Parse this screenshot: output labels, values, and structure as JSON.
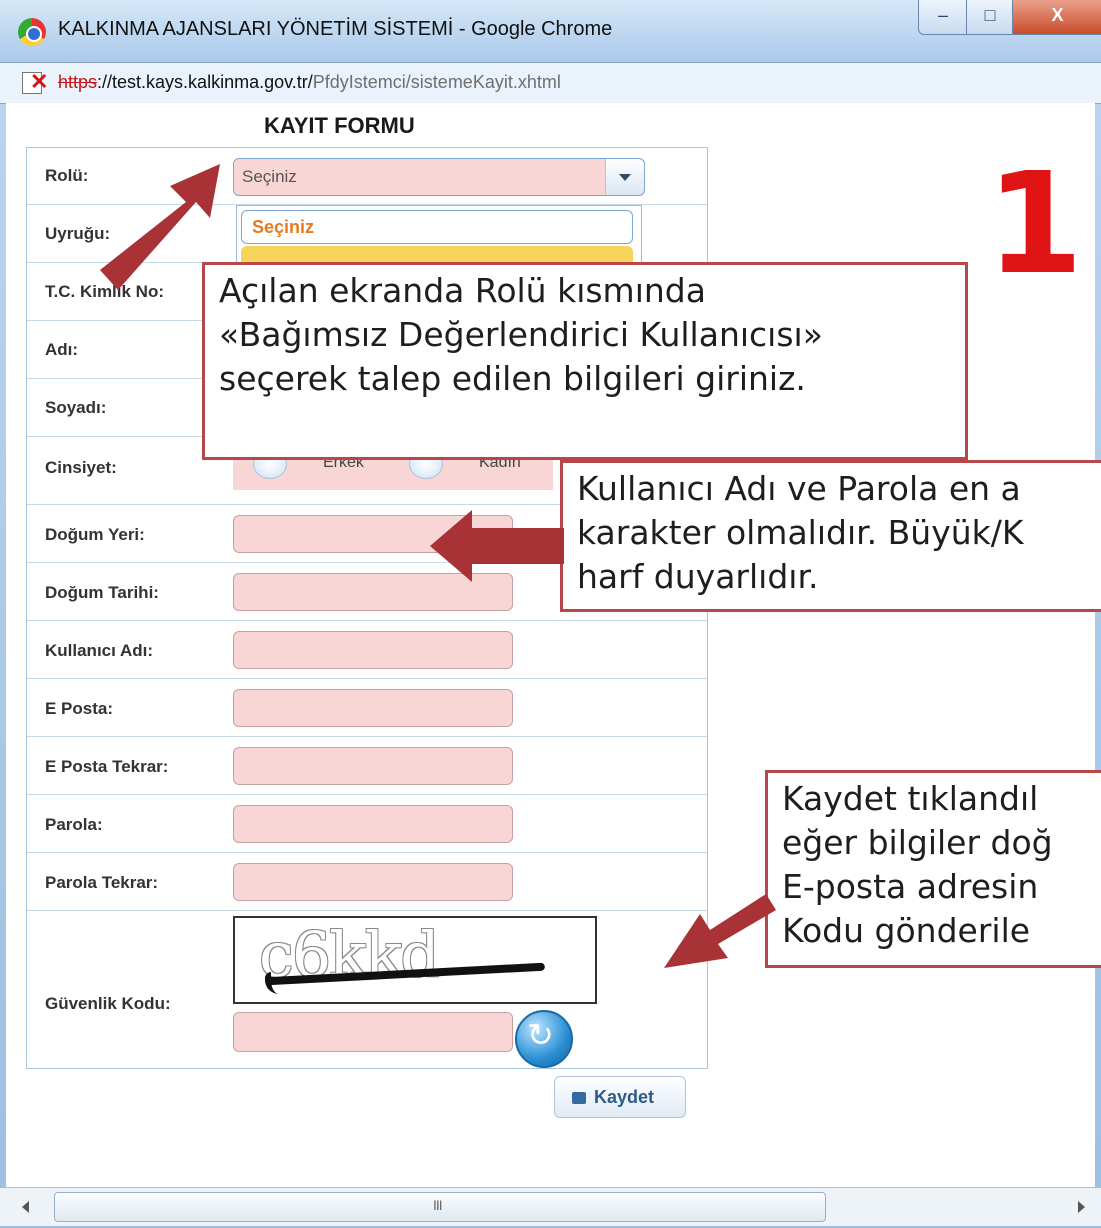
{
  "window": {
    "title": "KALKINMA AJANSLARI YÖNETİM SİSTEMİ - Google Chrome",
    "url_scheme": "https",
    "url_host": "://test.kays.kalkinma.gov.tr/",
    "url_path": "PfdyIstemci/sistemeKayit.xhtml",
    "minimize_glyph": "–",
    "maximize_glyph": "□",
    "close_glyph": "X"
  },
  "form": {
    "title": "KAYIT FORMU",
    "role": {
      "label": "Rolü:",
      "value": "Seçiniz",
      "dropdown_option": "Seçiniz"
    },
    "fields": [
      {
        "label": "Uyruğu:"
      },
      {
        "label": "T.C. Kimlik No:"
      },
      {
        "label": "Adı:"
      },
      {
        "label": "Soyadı:"
      }
    ],
    "gender": {
      "label": "Cinsiyet:",
      "options": [
        "Erkek",
        "Kadın"
      ]
    },
    "inputs": [
      {
        "label": "Doğum Yeri:"
      },
      {
        "label": "Doğum Tarihi:"
      },
      {
        "label": "Kullanıcı Adı:"
      },
      {
        "label": "E Posta:"
      },
      {
        "label": "E Posta Tekrar:"
      },
      {
        "label": "Parola:"
      },
      {
        "label": "Parola Tekrar:"
      }
    ],
    "captcha": {
      "label": "Güvenlik Kodu:",
      "text": "c6kkd"
    },
    "save_label": "Kaydet"
  },
  "annotations": {
    "big_number": "1",
    "callout_role": [
      "Açılan ekranda Rolü kısmında",
      "«Bağımsız Değerlendirici Kullanıcısı»",
      "seçerek talep edilen bilgileri giriniz."
    ],
    "callout_user": [
      "Kullanıcı Adı ve Parola en a",
      "karakter olmalıdır. Büyük/K",
      "harf duyarlıdır."
    ],
    "callout_save": [
      "Kaydet tıklandıl",
      "eğer bilgiler doğ",
      "E-posta adresin",
      "Kodu gönderile"
    ]
  },
  "scrollbar": {
    "grip": "III"
  },
  "colors": {
    "callout_border": "#b6484b",
    "arrow": "#a83236",
    "big_number": "#e01414",
    "field_bg": "#f9d6d6"
  }
}
